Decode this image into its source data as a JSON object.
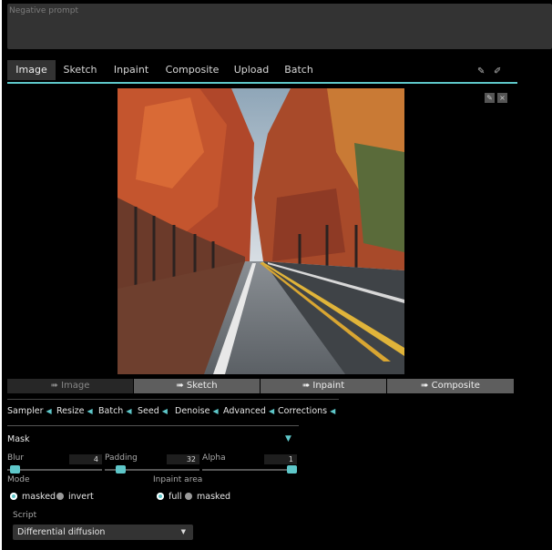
{
  "negative_prompt": {
    "placeholder": "Negative prompt",
    "value": ""
  },
  "tabs": [
    {
      "label": "Image",
      "active": true
    },
    {
      "label": "Sketch",
      "active": false
    },
    {
      "label": "Inpaint",
      "active": false
    },
    {
      "label": "Composite",
      "active": false
    },
    {
      "label": "Upload",
      "active": false
    },
    {
      "label": "Batch",
      "active": false
    }
  ],
  "tab_icons": [
    "pencil-icon",
    "eraser-icon"
  ],
  "image_controls": {
    "edit": "✎",
    "close": "×"
  },
  "send_buttons": [
    "➠ Image",
    "➠ Sketch",
    "➠ Inpaint",
    "➠ Composite"
  ],
  "accordions": [
    "Sampler",
    "Resize",
    "Batch",
    "Seed",
    "Denoise",
    "Advanced",
    "Corrections"
  ],
  "mask": {
    "title": "Mask",
    "arrow": "▼",
    "sliders": [
      {
        "label": "Blur",
        "value": "4",
        "level": 0.04
      },
      {
        "label": "Padding",
        "value": "32",
        "level": 0.16
      },
      {
        "label": "Alpha",
        "value": "1",
        "level": 1.0
      }
    ],
    "mode": {
      "label": "Mode",
      "options": [
        "masked",
        "invert"
      ],
      "selected": "masked"
    },
    "inpaint_area": {
      "label": "Inpaint area",
      "options": [
        "full",
        "masked"
      ],
      "selected": "full"
    }
  },
  "script": {
    "label": "Script",
    "value": "Differential diffusion",
    "caret": "▼"
  },
  "colors": {
    "accent": "#5ec7c9",
    "panel": "#333333",
    "background": "#000000"
  }
}
